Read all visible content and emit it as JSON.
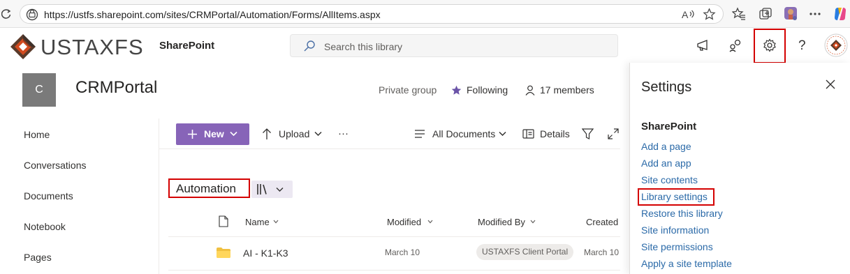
{
  "browser": {
    "url": "https://ustfs.sharepoint.com/sites/CRMPortal/Automation/Forms/AllItems.aspx"
  },
  "suite": {
    "logo_text": "USTAXFS",
    "app_name": "SharePoint",
    "search_placeholder": "Search this library"
  },
  "site": {
    "icon_letter": "C",
    "title": "CRMPortal",
    "privacy": "Private group",
    "following": "Following",
    "members": "17 members"
  },
  "nav": {
    "items": [
      {
        "label": "Home"
      },
      {
        "label": "Conversations"
      },
      {
        "label": "Documents"
      },
      {
        "label": "Notebook"
      },
      {
        "label": "Pages"
      }
    ]
  },
  "commandbar": {
    "new_label": "New",
    "upload_label": "Upload",
    "view_label": "All Documents",
    "details_label": "Details"
  },
  "library": {
    "title": "Automation",
    "columns": [
      "Name",
      "Modified",
      "Modified By",
      "Created"
    ],
    "rows": [
      {
        "name": "AI - K1-K3",
        "modified": "March 10",
        "modified_by": "USTAXFS Client Portal",
        "created": "March 10"
      }
    ]
  },
  "settings_pane": {
    "title": "Settings",
    "section": "SharePoint",
    "links": [
      "Add a page",
      "Add an app",
      "Site contents",
      "Library settings",
      "Restore this library",
      "Site information",
      "Site permissions",
      "Apply a site template"
    ]
  },
  "colors": {
    "accent": "#8764b8",
    "link": "#2b6aa8",
    "highlight": "#d40000"
  }
}
